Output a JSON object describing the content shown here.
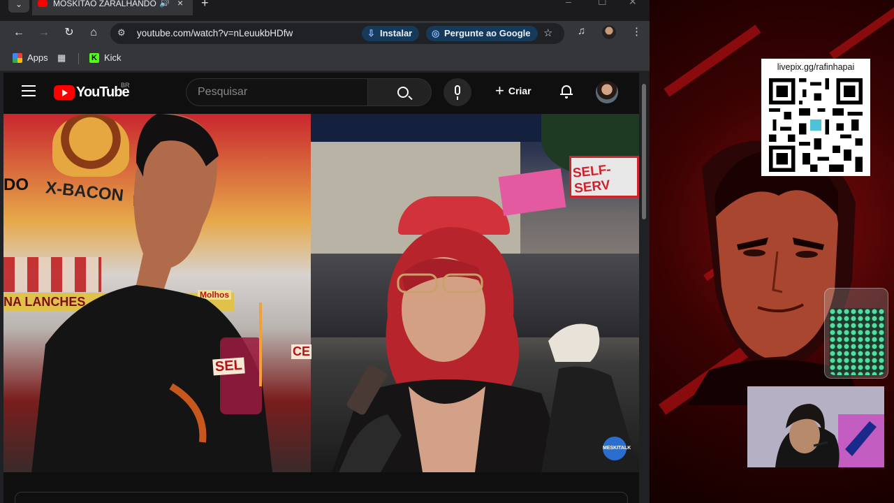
{
  "browser": {
    "tab": {
      "title": "MOSKITAO ZARALHANDO",
      "audio_icon": "speaker-icon",
      "close": "×"
    },
    "new_tab": "+",
    "url": "youtube.com/watch?v=nLeuukbHDfw",
    "install_label": "Instalar",
    "ask_google_label": "Pergunte ao Google",
    "bookmarks": [
      {
        "label": "Apps",
        "icon": "apps-grid-icon"
      },
      {
        "label": "Kick",
        "icon": "kick-icon"
      }
    ]
  },
  "youtube": {
    "logo_text": "YouTube",
    "country": "BR",
    "search_placeholder": "Pesquisar",
    "create_label": "Criar"
  },
  "video": {
    "signs": [
      "X-BACON",
      "HO",
      "DO",
      "NA LANCHES",
      "SELF-SERV",
      "SEL",
      "CE",
      "Molhos"
    ],
    "watermark": "MESKITALK"
  },
  "overlay": {
    "qr_label": "livepix.gg/rafinhapai"
  },
  "colors": {
    "yt_red": "#ff0000",
    "pill_bg": "#153a5a",
    "stream_red": "#7a0a0a"
  }
}
